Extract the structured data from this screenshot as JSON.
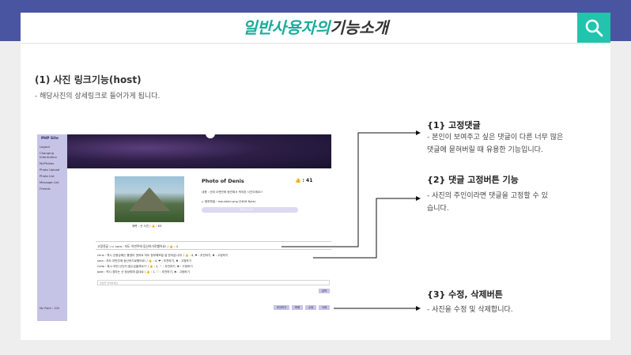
{
  "header": {
    "title_accent": "일반사용자의",
    "title_rest": "기능소개"
  },
  "section1": {
    "title": "(1) 사진 링크기능(host)",
    "desc": "-  해당사진의 상세링크로 들어가게 됩니다."
  },
  "screenshot": {
    "site_logo": "PHP Site",
    "menu": [
      "Logout",
      "Changing Information",
      "MyPhotos",
      "Photo Upload",
      "Photo List",
      "Message List",
      "Friends"
    ],
    "my_point": "My Point : 100",
    "photo_caption": "제목 : 산 사진 / 👍 : 63",
    "photo_title": "Photo of Denis",
    "likes": "👍 : 41",
    "content": "내용 : 산에 오랜만에 등반해서 찍어본 사진이에요!!",
    "file": "▷ 첨부파일 : mountain.png (5816 Byte)",
    "pill_label": "좋아요 누르기",
    "pinned": "고정댓글 => sara : 저도 이번주에 등산하기로했어요! / 👍 : 4",
    "comments": [
      "chris : 역시 산정상에는 풍경이 멋져요 저도 정부해보일 잘 받아갑니다! / 👍 : 4, ❤ : 추천하기, ✖ : 고정하기",
      "sara : 저도 이번주에 등산하기로했어요! / 👍 : 4, ❤ : 추천하기, ✖ : 고정하기",
      "Celia : 혹시 어떤 산인지 알수있을까요?? / 👍 : 2, ♡ : 추천하기, ✖ : 고정하기",
      "Jade : 역시 경치는 산 정상밖에 없네요 / 👍 : 1, ♡ : 추천하기, ✖ : 고정하기"
    ],
    "comment_placeholder": "댓글을 입력하세요",
    "submit_label": "입력",
    "buttons": [
      "추천하기",
      "목록",
      "수정",
      "삭제"
    ]
  },
  "notes": [
    {
      "title": "{1} 고정댓글",
      "lines": [
        "-  본인이 보여주고 싶은 댓글이 다른 너무 많은",
        "   댓글에 묻혀버릴 때 유용한 기능입니다."
      ]
    },
    {
      "title": "{2} 댓글 고정버튼 기능",
      "lines": [
        "-  사진의 주인이라면 댓글을 고정할 수 있",
        "   습니다."
      ]
    },
    {
      "title": "{3} 수정, 삭제버튼",
      "lines": [
        "-  사진을 수정 및 삭제합니다."
      ]
    }
  ],
  "colors": {
    "band": "#4a55a2",
    "accent": "#1aab9b",
    "search": "#22c4ae",
    "sidebar": "#c5c3e6"
  },
  "icons": {
    "search": "search-icon"
  }
}
